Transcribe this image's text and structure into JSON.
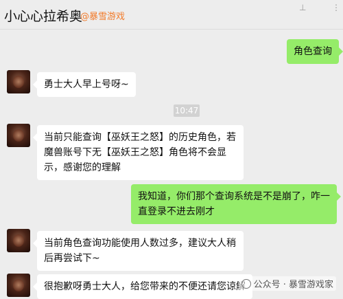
{
  "header": {
    "title": "小心心拉希奥",
    "tag": "@暴雪游戏",
    "icons": [
      "pin-icon",
      "more-icon"
    ]
  },
  "messages": [
    {
      "side": "right",
      "text": "角色查询"
    },
    {
      "side": "left",
      "text": "勇士大人早上号呀~"
    },
    {
      "side": "time",
      "text": "10:47"
    },
    {
      "side": "left",
      "text": "当前只能查询【巫妖王之怒】的历史角色，若魔兽账号下无【巫妖王之怒】角色将不会显示，感谢您的理解"
    },
    {
      "side": "right",
      "text": "我知道，你们那个查询系统是不是崩了，咋一直登录不进去刚才"
    },
    {
      "side": "left",
      "text": "当前角色查询功能使用人数过多，建议大人稍后再尝试下~"
    },
    {
      "side": "left",
      "text": "很抱歉呀勇士大人，给您带来的不便还请您谅解"
    }
  ],
  "watermark": {
    "text": "公众号 · 暴雪游戏家",
    "icon": "wechat-official-account-icon"
  }
}
